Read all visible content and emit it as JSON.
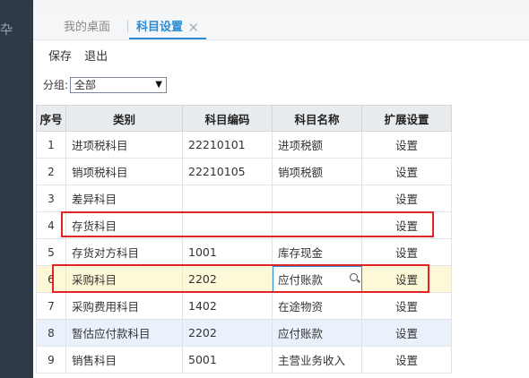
{
  "tabs": [
    {
      "label": "我的桌面",
      "active": false
    },
    {
      "label": "科目设置",
      "active": true,
      "close": "✕"
    }
  ],
  "toolbar": {
    "save": "保存",
    "exit": "退出"
  },
  "group": {
    "label": "分组:",
    "selected": "全部"
  },
  "table": {
    "headers": [
      "序号",
      "类别",
      "科目编码",
      "科目名称",
      "扩展设置"
    ],
    "rows": [
      {
        "no": "1",
        "category": "进项税科目",
        "code": "22210101",
        "name": "进项税额",
        "ext": "设置"
      },
      {
        "no": "2",
        "category": "销项税科目",
        "code": "22210105",
        "name": "销项税额",
        "ext": "设置"
      },
      {
        "no": "3",
        "category": "差异科目",
        "code": "",
        "name": "",
        "ext": "设置"
      },
      {
        "no": "4",
        "category": "存货科目",
        "code": "",
        "name": "",
        "ext": "设置"
      },
      {
        "no": "5",
        "category": "存货对方科目",
        "code": "1001",
        "name": "库存现金",
        "ext": "设置"
      },
      {
        "no": "6",
        "category": "采购科目",
        "code": "2202",
        "name": "应付账款",
        "ext": "设置"
      },
      {
        "no": "7",
        "category": "采购费用科目",
        "code": "1402",
        "name": "在途物资",
        "ext": "设置"
      },
      {
        "no": "8",
        "category": "暂估应付款科目",
        "code": "2202",
        "name": "应付账款",
        "ext": "设置"
      },
      {
        "no": "9",
        "category": "销售科目",
        "code": "5001",
        "name": "主营业务收入",
        "ext": "设置"
      }
    ]
  },
  "colors": {
    "accent": "#2b8cd6",
    "highlight_box": "#e02424",
    "row_highlight": "#fdf8d8",
    "row_selected": "#e9f2fb"
  }
}
